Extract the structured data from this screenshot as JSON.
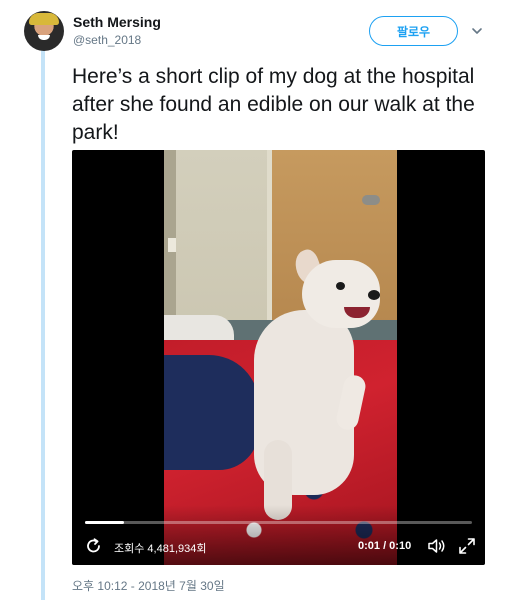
{
  "user": {
    "name": "Seth Mersing",
    "handle": "@seth_2018",
    "avatar_icon": "profile-photo"
  },
  "header": {
    "follow_label": "팔로우",
    "more_icon": "chevron-down-icon"
  },
  "tweet": {
    "text": "Here’s a short clip of my dog at the hospital after she found an edible on our walk at the park!",
    "timestamp": "오후 10:12 - 2018년 7월 30일"
  },
  "video": {
    "views_label": "조회수 4,481,934회",
    "time_display": "0:01 / 0:10",
    "progress_fraction": 0.1,
    "icons": [
      "replay-icon",
      "volume-icon",
      "fullscreen-icon"
    ]
  },
  "colors": {
    "accent": "#1da1f2",
    "thread_line": "#c4e3f8",
    "text_primary": "#14171a",
    "text_secondary": "#657786"
  }
}
